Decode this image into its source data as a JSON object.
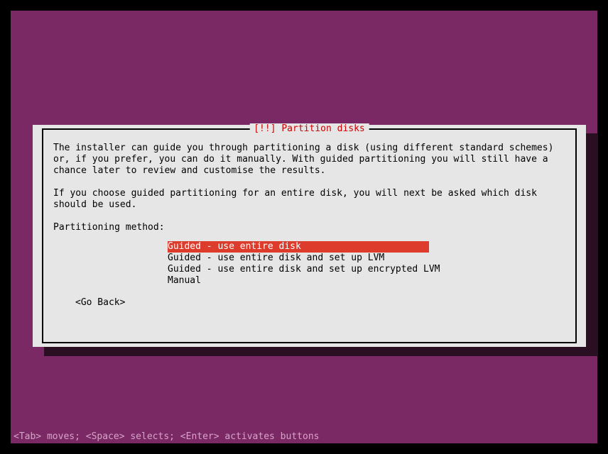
{
  "dialog": {
    "title": "[!!] Partition disks",
    "paragraph1": "The installer can guide you through partitioning a disk (using different standard schemes) or, if you prefer, you can do it manually. With guided partitioning you will still have a chance later to review and customise the results.",
    "paragraph2": "If you choose guided partitioning for an entire disk, you will next be asked which disk should be used.",
    "prompt": "Partitioning method:",
    "options": [
      "Guided - use entire disk",
      "Guided - use entire disk and set up LVM",
      "Guided - use entire disk and set up encrypted LVM",
      "Manual"
    ],
    "go_back": "<Go Back>"
  },
  "statusbar": "<Tab> moves; <Space> selects; <Enter> activates buttons"
}
